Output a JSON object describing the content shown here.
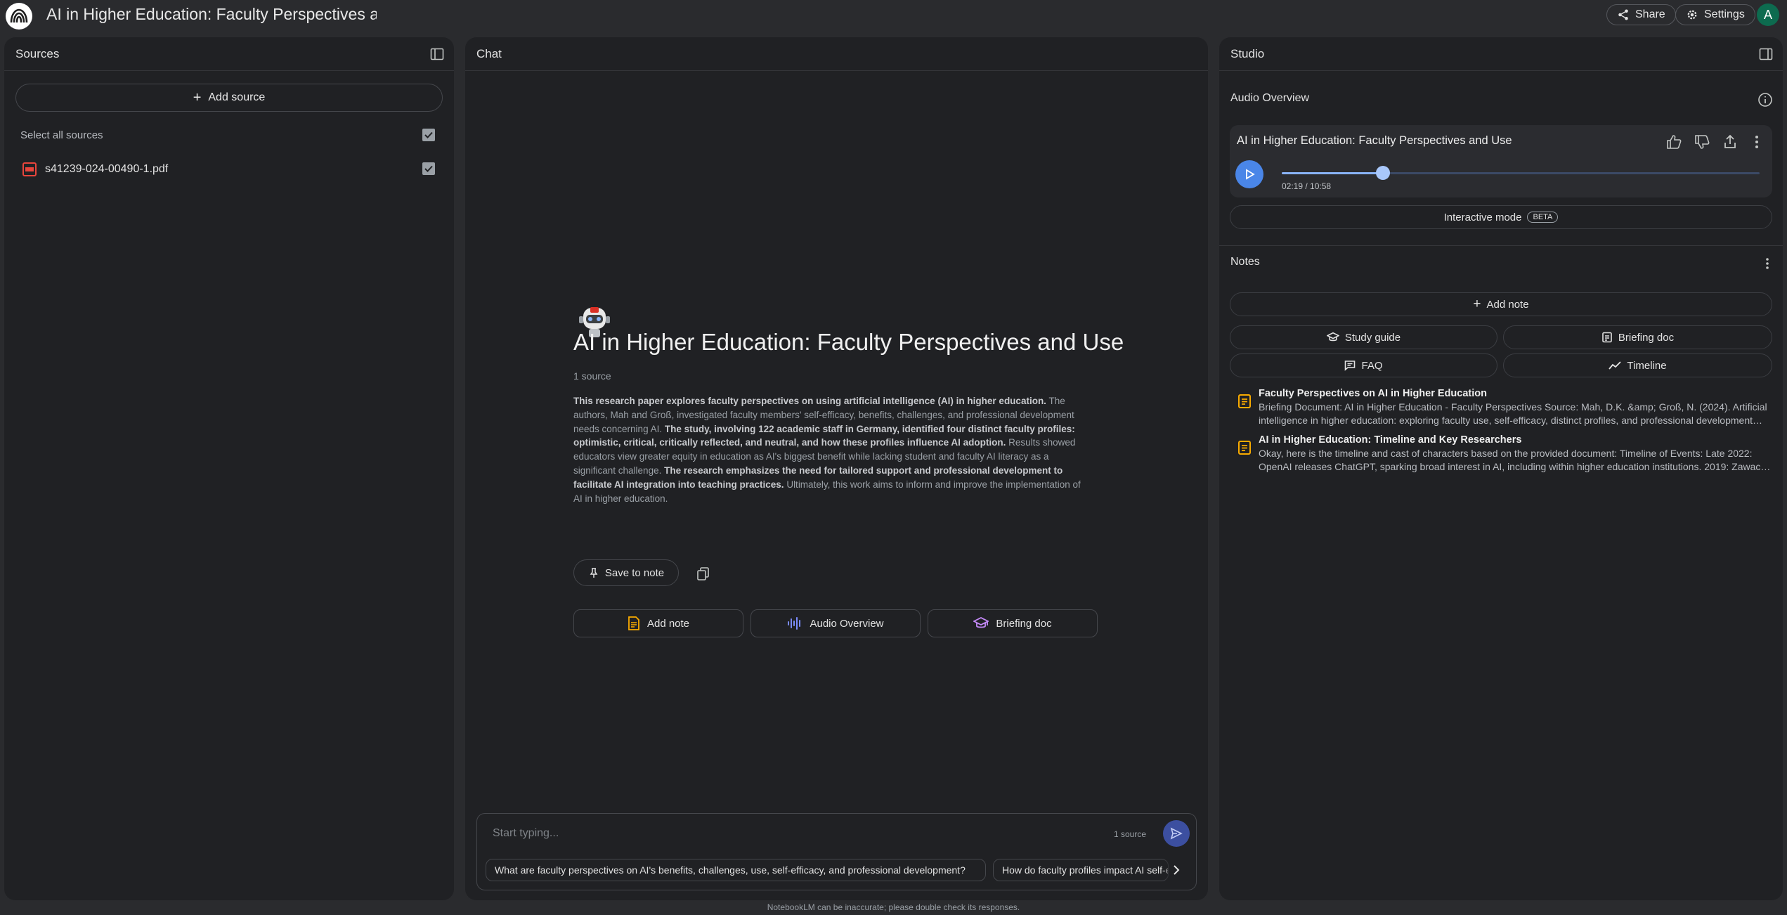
{
  "app": {
    "title": "AI in Higher Education: Faculty Perspectives and Use",
    "share_label": "Share",
    "settings_label": "Settings",
    "avatar_letter": "A"
  },
  "sources": {
    "header": "Sources",
    "add_source_label": "Add source",
    "select_all_label": "Select all sources",
    "items": [
      {
        "name": "s41239-024-00490-1.pdf",
        "icon": "pdf-icon",
        "checked": true
      }
    ]
  },
  "chat": {
    "header": "Chat",
    "title": "AI in Higher Education: Faculty Perspectives and Use",
    "source_count": "1 source",
    "summary": [
      {
        "text": "This research paper explores faculty perspectives on using artificial intelligence (AI) in higher education.",
        "bold": true
      },
      {
        "text": " The authors, Mah and Groß, investigated faculty members' self-efficacy, benefits, challenges, and professional development needs concerning AI. ",
        "bold": false
      },
      {
        "text": "The study, involving 122 academic staff in Germany, identified four distinct faculty profiles: optimistic, critical, critically reflected, and neutral, and how these profiles influence AI adoption.",
        "bold": true
      },
      {
        "text": " Results showed educators view greater equity in education as AI's biggest benefit while lacking student and faculty AI literacy as a significant challenge. ",
        "bold": false
      },
      {
        "text": "The research emphasizes the need for tailored support and professional development to facilitate AI integration into teaching practices.",
        "bold": true
      },
      {
        "text": " Ultimately, this work aims to inform and improve the implementation of AI in higher education.",
        "bold": false
      }
    ],
    "save_to_note_label": "Save to note",
    "actions": [
      {
        "label": "Add note",
        "icon": "note-icon",
        "color": "#f9ab00"
      },
      {
        "label": "Audio Overview",
        "icon": "waveform-icon",
        "color": "#7b8cff"
      },
      {
        "label": "Briefing doc",
        "icon": "graduation-cap-icon",
        "color": "#c58af9"
      }
    ],
    "input_placeholder": "Start typing...",
    "input_source_count": "1 source",
    "suggestions": [
      "What are faculty perspectives on AI's benefits, challenges, use, self-efficacy, and professional development?",
      "How do faculty profiles impact AI self-efficacy?"
    ],
    "footer": "NotebookLM can be inaccurate; please double check its responses."
  },
  "studio": {
    "header": "Studio",
    "audio_overview_label": "Audio Overview",
    "audio": {
      "title": "AI in Higher Education: Faculty Perspectives and Use",
      "time": "02:19 / 10:58",
      "progress_fraction": 0.212
    },
    "interactive_label": "Interactive mode",
    "beta_label": "BETA",
    "notes_label": "Notes",
    "add_note_label": "Add note",
    "note_buttons": [
      {
        "label": "Study guide",
        "icon": "graduation-cap-icon"
      },
      {
        "label": "Briefing doc",
        "icon": "document-icon"
      },
      {
        "label": "FAQ",
        "icon": "faq-icon"
      },
      {
        "label": "Timeline",
        "icon": "timeline-icon"
      }
    ],
    "notes": [
      {
        "title": "Faculty Perspectives on AI in Higher Education",
        "body": "Briefing Document: AI in Higher Education - Faculty Perspectives Source: Mah, D.K. &amp; Groß, N. (2024). Artificial intelligence in higher education: exploring faculty use, self-efficacy, distinct profiles, and professional development needs."
      },
      {
        "title": "AI in Higher Education: Timeline and Key Researchers",
        "body": "Okay, here is the timeline and cast of characters based on the provided document: Timeline of Events: Late 2022: OpenAI releases ChatGPT, sparking broad interest in AI, including within higher education institutions. 2019: Zawacki-Richter et al. publish a systematic review."
      }
    ]
  }
}
